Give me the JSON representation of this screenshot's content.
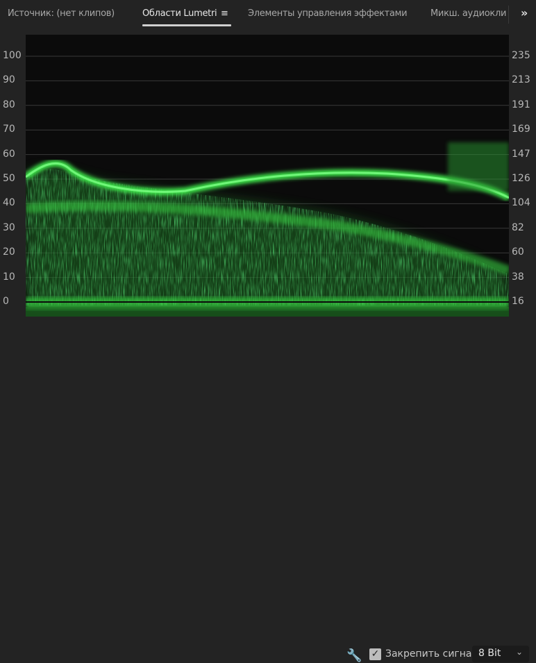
{
  "tabs": [
    {
      "label": "Источник: (нет клипов)",
      "active": false
    },
    {
      "label": "Области Lumetri",
      "active": true,
      "menu_icon": "hamburger-icon"
    },
    {
      "label": "Элементы управления эффектами",
      "active": false
    },
    {
      "label": "Микш. аудиокли",
      "active": false
    }
  ],
  "overflow_icon": "»",
  "menu_glyph": "≡",
  "scope": {
    "type": "waveform",
    "color": "#2ecc40",
    "left_scale": [
      "100",
      "90",
      "80",
      "70",
      "60",
      "50",
      "40",
      "30",
      "20",
      "10",
      "0"
    ],
    "right_scale": [
      "235",
      "213",
      "191",
      "169",
      "147",
      "126",
      "104",
      "82",
      "60",
      "38",
      "16"
    ]
  },
  "footer": {
    "wrench_icon": "🔧",
    "lock_signal_label": "Закрепить сигнал",
    "lock_signal_checked": true,
    "check_glyph": "✓",
    "bit_depth": "8 Bit",
    "chevron": "⌄"
  }
}
